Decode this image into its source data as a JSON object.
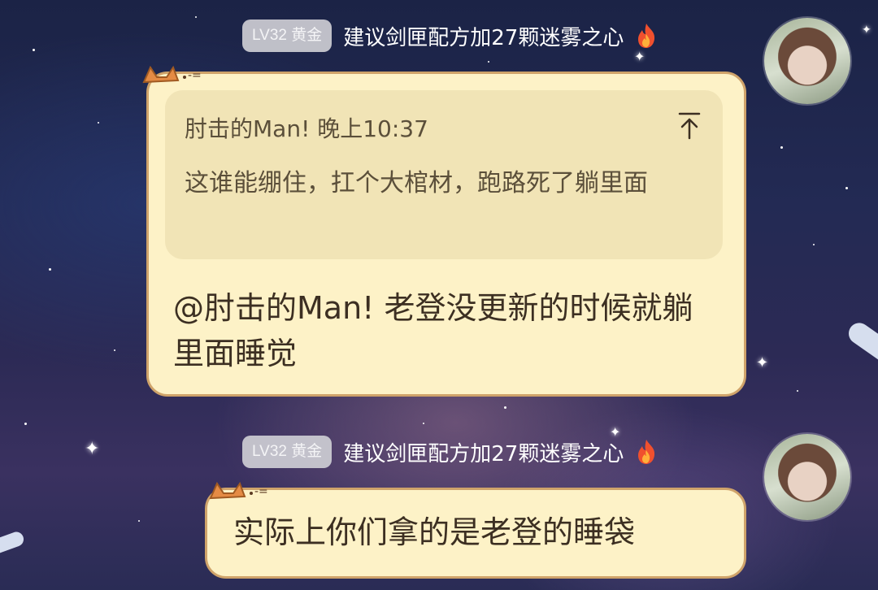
{
  "messages": [
    {
      "level_badge": "LV32 黄金",
      "username": "建议剑匣配方加27颗迷雾之心",
      "badge_icon": "fire-icon",
      "avatar_icon": "avatar-girl-icon",
      "quote": {
        "author_time": "肘击的Man! 晚上10:37",
        "text": "这谁能绷住，扛个大棺材，跑路死了躺里面",
        "action_icon": "jump-to-top-icon"
      },
      "content": "@肘击的Man! 老登没更新的时候就躺里面睡觉"
    },
    {
      "level_badge": "LV32 黄金",
      "username": "建议剑匣配方加27颗迷雾之心",
      "badge_icon": "fire-icon",
      "avatar_icon": "avatar-girl-icon",
      "content": "实际上你们拿的是老登的睡袋"
    }
  ],
  "colors": {
    "bubble_fill": "#fdf2c7",
    "bubble_border": "#cfa36a",
    "quote_fill": "#f1e4b6",
    "text": "#3c2f22",
    "badge": "#cdcdd4"
  }
}
